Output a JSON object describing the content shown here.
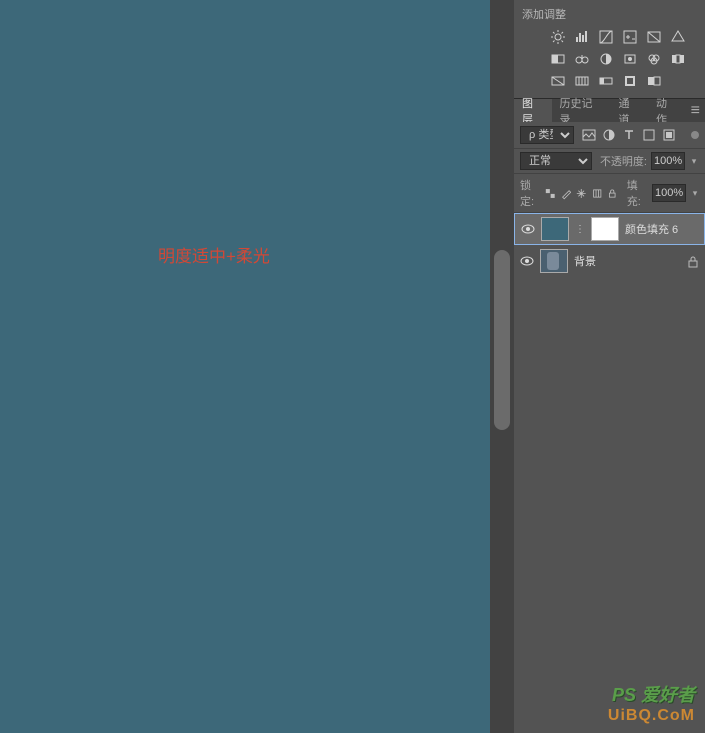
{
  "canvas": {
    "annotation": "明度适中+柔光"
  },
  "adjustments": {
    "title": "添加调整"
  },
  "tabs": {
    "items": [
      {
        "label": "图层",
        "active": true
      },
      {
        "label": "历史记录",
        "active": false
      },
      {
        "label": "通道",
        "active": false
      },
      {
        "label": "动作",
        "active": false
      }
    ]
  },
  "filter": {
    "kind_prefix": "ρ",
    "kind": "类型"
  },
  "blend": {
    "mode": "正常",
    "opacity_label": "不透明度:",
    "opacity": "100%"
  },
  "lock": {
    "label": "锁定:",
    "fill_label": "填充:",
    "fill": "100%"
  },
  "layers": [
    {
      "name": "颜色填充 6",
      "selected": true,
      "has_mask": true,
      "locked": false
    },
    {
      "name": "背景",
      "selected": false,
      "has_mask": false,
      "locked": true
    }
  ],
  "watermark": {
    "line1": "PS 爱好者",
    "line2": "UiBQ.CoM"
  }
}
